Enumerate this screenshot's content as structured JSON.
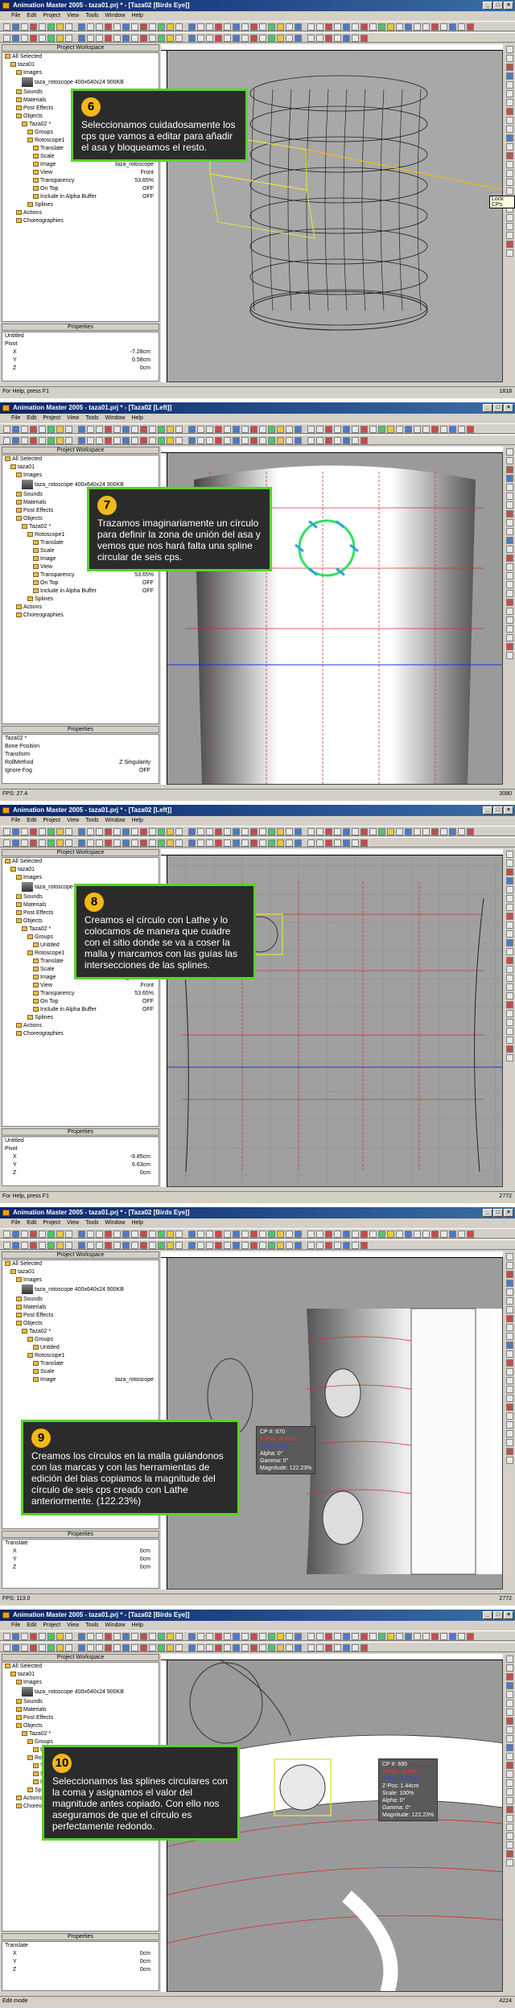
{
  "app": {
    "menus": [
      "File",
      "Edit",
      "Project",
      "View",
      "Tools",
      "Window",
      "Help"
    ],
    "workspace_title": "Project Workspace",
    "properties_title": "Properties"
  },
  "panels": [
    {
      "title": "Animation Master 2005 - taza01.prj * - [Taza02 [Birds Eye]]",
      "status_left": "For Help, press F1",
      "status_right": "1818",
      "callout_num": "6",
      "callout_text": "Seleccionamos cuidadosamente los cps que vamos a editar para añadir el asa y bloqueamos el resto.",
      "tooltip": "Lock CPs",
      "tree": [
        {
          "label": "All Selected",
          "indent": 0
        },
        {
          "label": "taza01",
          "indent": 1
        },
        {
          "label": "Images",
          "indent": 2
        },
        {
          "label": "taza_rotoscope 400x640x24 900KB",
          "indent": 3,
          "thumb": true
        },
        {
          "label": "Sounds",
          "indent": 2
        },
        {
          "label": "Materials",
          "indent": 2
        },
        {
          "label": "Post Effects",
          "indent": 2
        },
        {
          "label": "Objects",
          "indent": 2
        },
        {
          "label": "Taza02 *",
          "indent": 3
        },
        {
          "label": "Groups",
          "indent": 4
        },
        {
          "label": "Rotoscope1",
          "indent": 4
        },
        {
          "label": "Translate",
          "indent": 5
        },
        {
          "label": "Scale",
          "indent": 5
        },
        {
          "label": "Image",
          "indent": 5,
          "value": "taza_rotoscope",
          "thumb2": true
        },
        {
          "label": "View",
          "indent": 5,
          "value": "Front"
        },
        {
          "label": "Transparency",
          "indent": 5,
          "value": "53.65%"
        },
        {
          "label": "On Top",
          "indent": 5,
          "value": "OFF"
        },
        {
          "label": "Include in Alpha Buffer",
          "indent": 5,
          "value": "OFF"
        },
        {
          "label": "Splines",
          "indent": 4
        },
        {
          "label": "Actions",
          "indent": 2
        },
        {
          "label": "Choreographies",
          "indent": 2
        }
      ],
      "props": [
        {
          "label": "Untitled",
          "indent": 0
        },
        {
          "label": "Pivot",
          "indent": 0
        },
        {
          "label": "X",
          "indent": 1,
          "value": "-7.28cm"
        },
        {
          "label": "Y",
          "indent": 1,
          "value": "0.58cm"
        },
        {
          "label": "Z",
          "indent": 1,
          "value": "0cm"
        }
      ]
    },
    {
      "title": "Animation Master 2005 - taza01.prj * - [Taza02 [Left]]",
      "status_left": "FPS: 27.4",
      "status_right": "3080",
      "callout_num": "7",
      "callout_text": "Trazamos imaginariamente un círculo para definir la zona de unión del asa y vemos que nos hará falta una spline circular de seis cps.",
      "tree": [
        {
          "label": "All Selected",
          "indent": 0
        },
        {
          "label": "taza01",
          "indent": 1
        },
        {
          "label": "Images",
          "indent": 2
        },
        {
          "label": "taza_rotoscope 400x640x24 900KB",
          "indent": 3,
          "thumb": true
        },
        {
          "label": "Sounds",
          "indent": 2
        },
        {
          "label": "Materials",
          "indent": 2
        },
        {
          "label": "Post Effects",
          "indent": 2
        },
        {
          "label": "Objects",
          "indent": 2
        },
        {
          "label": "Taza02 *",
          "indent": 3
        },
        {
          "label": "Rotoscope1",
          "indent": 4
        },
        {
          "label": "Translate",
          "indent": 5
        },
        {
          "label": "Scale",
          "indent": 5
        },
        {
          "label": "Image",
          "indent": 5,
          "value": "taza_rotoscope",
          "thumb2": true
        },
        {
          "label": "View",
          "indent": 5,
          "value": "Front"
        },
        {
          "label": "Transparency",
          "indent": 5,
          "value": "53.65%"
        },
        {
          "label": "On Top",
          "indent": 5,
          "value": "OFF"
        },
        {
          "label": "Include in Alpha Buffer",
          "indent": 5,
          "value": "OFF"
        },
        {
          "label": "Splines",
          "indent": 4
        },
        {
          "label": "Actions",
          "indent": 2
        },
        {
          "label": "Choreographies",
          "indent": 2
        }
      ],
      "props": [
        {
          "label": "Taza02 *",
          "indent": 0
        },
        {
          "label": "Bone Position",
          "indent": 0
        },
        {
          "label": "Transform",
          "indent": 0
        },
        {
          "label": "RollMethod",
          "indent": 0,
          "value": "Z Singularity"
        },
        {
          "label": "Ignore Fog",
          "indent": 0,
          "value": "OFF"
        }
      ]
    },
    {
      "title": "Animation Master 2005 - taza01.prj * - [Taza02 [Left]]",
      "status_left": "For Help, press F1",
      "status_right": "2772",
      "callout_num": "8",
      "callout_text": "Creamos el círculo con Lathe y lo colocamos de manera que cuadre con el sitio donde se va a coser la malla y marcamos con las guías las intersecciones de las splines.",
      "tree": [
        {
          "label": "All Selected",
          "indent": 0
        },
        {
          "label": "taza01",
          "indent": 1
        },
        {
          "label": "Images",
          "indent": 2
        },
        {
          "label": "taza_rotoscope 400x640x24 900KB",
          "indent": 3,
          "thumb": true
        },
        {
          "label": "Sounds",
          "indent": 2
        },
        {
          "label": "Materials",
          "indent": 2
        },
        {
          "label": "Post Effects",
          "indent": 2
        },
        {
          "label": "Objects",
          "indent": 2
        },
        {
          "label": "Taza02 *",
          "indent": 3
        },
        {
          "label": "Groups",
          "indent": 4
        },
        {
          "label": "Untitled",
          "indent": 5
        },
        {
          "label": "Rotoscope1",
          "indent": 4
        },
        {
          "label": "Translate",
          "indent": 5
        },
        {
          "label": "Scale",
          "indent": 5
        },
        {
          "label": "Image",
          "indent": 5,
          "value": "taza_rotoscope",
          "thumb2": true
        },
        {
          "label": "View",
          "indent": 5,
          "value": "Front"
        },
        {
          "label": "Transparency",
          "indent": 5,
          "value": "53.65%"
        },
        {
          "label": "On Top",
          "indent": 5,
          "value": "OFF"
        },
        {
          "label": "Include in Alpha Buffer",
          "indent": 5,
          "value": "OFF"
        },
        {
          "label": "Splines",
          "indent": 4
        },
        {
          "label": "Actions",
          "indent": 2
        },
        {
          "label": "Choreographies",
          "indent": 2
        }
      ],
      "props": [
        {
          "label": "Untitled",
          "indent": 0
        },
        {
          "label": "Pivot",
          "indent": 0
        },
        {
          "label": "X",
          "indent": 1,
          "value": "-9.85cm"
        },
        {
          "label": "Y",
          "indent": 1,
          "value": "6.63cm"
        },
        {
          "label": "Z",
          "indent": 1,
          "value": "0cm"
        }
      ]
    },
    {
      "title": "Animation Master 2005 - taza01.prj * - [Taza02 [Birds Eye]]",
      "status_left": "FPS: 113.0",
      "status_right": "2772",
      "callout_num": "9",
      "callout_text": "Creamos los círculos en la malla guiándonos con las marcas y con las herramientas de edición del bias copiamos la magnitude del círculo de seis cps creado con Lathe anteriormente. (122.23%)",
      "info": [
        "CP #: 670",
        "X-Pos: -0.8cm",
        "Z-Pos: 0cm",
        "Alpha: 0°",
        "Gamma: 0°",
        "Magnitude: 122.23%"
      ],
      "tree": [
        {
          "label": "All Selected",
          "indent": 0
        },
        {
          "label": "taza01",
          "indent": 1
        },
        {
          "label": "Images",
          "indent": 2
        },
        {
          "label": "taza_rotoscope 400x640x24 900KB",
          "indent": 3,
          "thumb": true
        },
        {
          "label": "Sounds",
          "indent": 2
        },
        {
          "label": "Materials",
          "indent": 2
        },
        {
          "label": "Post Effects",
          "indent": 2
        },
        {
          "label": "Objects",
          "indent": 2
        },
        {
          "label": "Taza02 *",
          "indent": 3
        },
        {
          "label": "Groups",
          "indent": 4
        },
        {
          "label": "Untitled",
          "indent": 5
        },
        {
          "label": "Rotoscope1",
          "indent": 4
        },
        {
          "label": "Translate",
          "indent": 5
        },
        {
          "label": "Scale",
          "indent": 5
        },
        {
          "label": "Image",
          "indent": 5,
          "value": "taza_rotoscope",
          "thumb2": true
        }
      ],
      "props": [
        {
          "label": "Translate",
          "indent": 0
        },
        {
          "label": "X",
          "indent": 1,
          "value": "0cm"
        },
        {
          "label": "Y",
          "indent": 1,
          "value": "0cm"
        },
        {
          "label": "Z",
          "indent": 1,
          "value": "0cm"
        }
      ]
    },
    {
      "title": "Animation Master 2005 - taza01.prj * - [Taza02 [Birds Eye]]",
      "status_left": "Edit mode",
      "status_right": "4224",
      "callout_num": "10",
      "callout_text": "Seleccionamos las splines circulares con la coma y asignamos el valor del magnitude antes copiado. Con ello nos aseguramos de que el círculo es perfectamente redondo.",
      "info": [
        "CP #: 695",
        "X-Pos: -0.8cm",
        "Y-Pos: 4.73cm",
        "Z-Pos: 1.44cm",
        "Scale: 100%",
        "Alpha: 0°",
        "Gamma: 0°",
        "Magnitude: 122.23%"
      ],
      "tree": [
        {
          "label": "All Selected",
          "indent": 0
        },
        {
          "label": "taza01",
          "indent": 1
        },
        {
          "label": "Images",
          "indent": 2
        },
        {
          "label": "taza_rotoscope 400x640x24 900KB",
          "indent": 3,
          "thumb": true
        },
        {
          "label": "Sounds",
          "indent": 2
        },
        {
          "label": "Materials",
          "indent": 2
        },
        {
          "label": "Post Effects",
          "indent": 2
        },
        {
          "label": "Objects",
          "indent": 2
        },
        {
          "label": "Taza02 *",
          "indent": 3
        },
        {
          "label": "Groups",
          "indent": 4
        },
        {
          "label": "Untitled",
          "indent": 5
        },
        {
          "label": "Rotoscope1",
          "indent": 4
        },
        {
          "label": "Translate",
          "indent": 5
        },
        {
          "label": "Scale",
          "indent": 5
        },
        {
          "label": "Image",
          "indent": 5,
          "value": "taza_rotoscope",
          "thumb2": true
        },
        {
          "label": "Splines",
          "indent": 4
        },
        {
          "label": "Actions",
          "indent": 2
        },
        {
          "label": "Choreographies",
          "indent": 2
        }
      ],
      "props": [
        {
          "label": "Translate",
          "indent": 0
        },
        {
          "label": "X",
          "indent": 1,
          "value": "0cm"
        },
        {
          "label": "Y",
          "indent": 1,
          "value": "0cm"
        },
        {
          "label": "Z",
          "indent": 1,
          "value": "0cm"
        }
      ]
    }
  ],
  "colors": {
    "callout_border": "#5ad22a",
    "callout_bg": "#2b2b2b",
    "badge": "#f2b81a",
    "spline_red": "#d03030",
    "spline_blue": "#2030d0",
    "selection_yellow": "#e8e040",
    "lathe_circle_green": "#30e060",
    "cp_cyan": "#30a0e0"
  },
  "icons": [
    "app-icon",
    "minimize-icon",
    "maximize-icon",
    "close-icon",
    "folder-icon",
    "expand-icon",
    "lock-icon"
  ]
}
